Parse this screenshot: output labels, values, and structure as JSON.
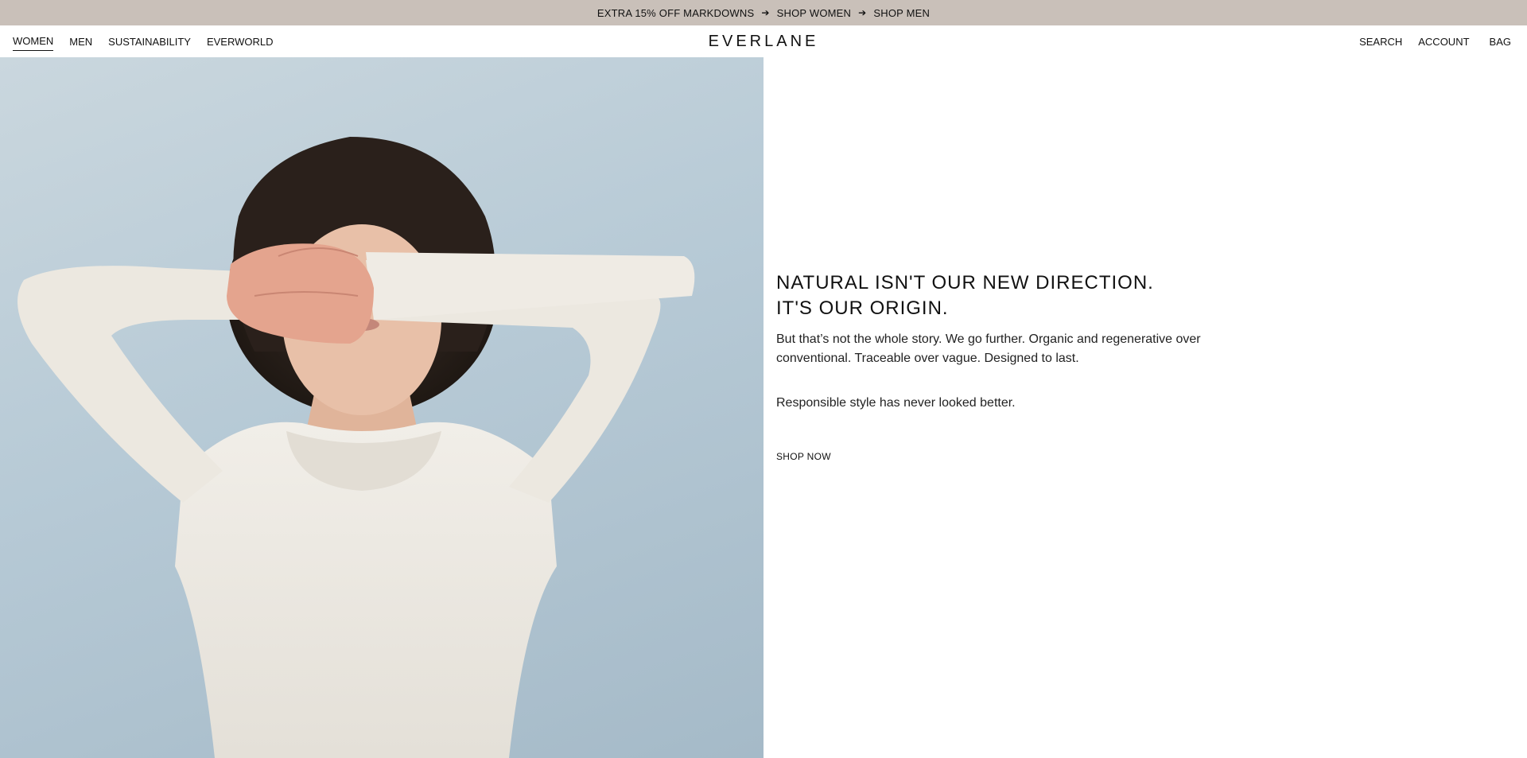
{
  "promo": {
    "text": "EXTRA 15% OFF MARKDOWNS",
    "link1": "SHOP WOMEN",
    "link2": "SHOP MEN",
    "arrow": "➔"
  },
  "nav": {
    "left": [
      "WOMEN",
      "MEN",
      "SUSTAINABILITY",
      "EVERWORLD"
    ],
    "logo": "EVERLANE",
    "right": [
      "SEARCH",
      "ACCOUNT",
      "BAG"
    ]
  },
  "hero": {
    "headline_line1": "NATURAL ISN'T OUR NEW DIRECTION.",
    "headline_line2": "IT'S OUR ORIGIN.",
    "body": "But that’s not the whole story. We go further. Organic and regenerative over conventional. Traceable over vague. Designed to last.",
    "tagline": "Responsible style has never looked better.",
    "cta": "SHOP NOW"
  },
  "colors": {
    "promo_bg": "#c9c0b9",
    "photo_bg": "#b7cad6",
    "sweater": "#ece8e0"
  }
}
